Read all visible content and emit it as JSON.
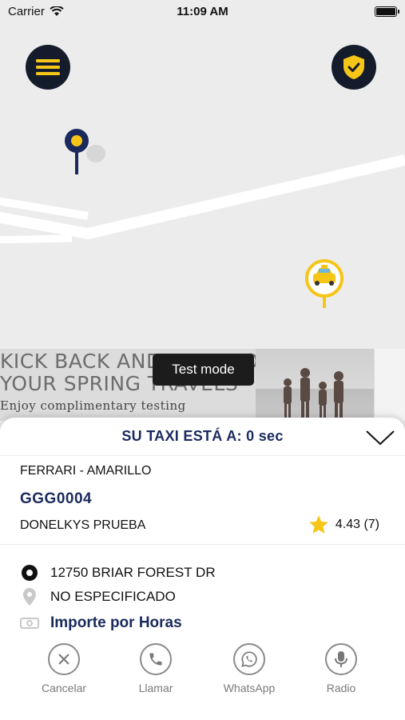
{
  "status_bar": {
    "carrier": "Carrier",
    "time": "11:09 AM"
  },
  "banner": {
    "line1": "KICK BACK AND RELAX ON",
    "line2": "YOUR SPRING TRAVELS",
    "line3": "Enjoy complimentary testing"
  },
  "toast": "Test mode",
  "trip": {
    "eta": "SU TAXI ESTÁ A: 0 sec",
    "vehicle": "FERRARI - AMARILLO",
    "plate": "GGG0004",
    "driver": "DONELKYS PRUEBA",
    "rating": "4.43 (7)",
    "pickup": "12750 BRIAR FOREST DR",
    "destination": "NO ESPECIFICADO",
    "fare_type": "Importe por Horas"
  },
  "actions": {
    "cancel": "Cancelar",
    "call": "Llamar",
    "whatsapp": "WhatsApp",
    "radio": "Radio"
  },
  "colors": {
    "accent": "#f5c518",
    "navy": "#1a2a5c",
    "dark_button": "#141c2b"
  }
}
